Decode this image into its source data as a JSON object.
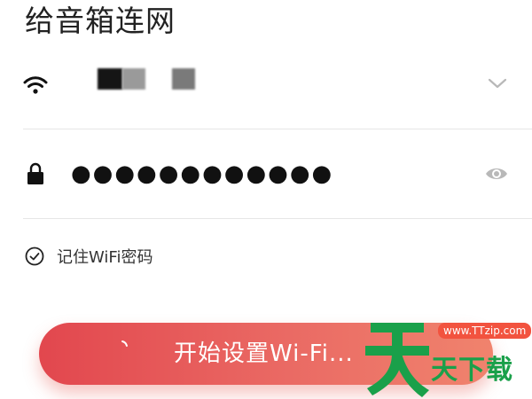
{
  "page": {
    "title": "给音箱连网"
  },
  "wifi": {
    "icon": "wifi-icon",
    "ssid": "",
    "ssid_obscured": true,
    "dropdown_icon": "chevron-down-icon"
  },
  "password": {
    "icon": "lock-icon",
    "value": "●●●●●●●●●●●●",
    "type": "password",
    "toggle_icon": "eye-icon"
  },
  "remember": {
    "icon": "check-circle-icon",
    "label": "记住WiFi密码",
    "checked": true
  },
  "start_button": {
    "label": "开始设置Wi-Fi...",
    "loading": true
  },
  "watermark": {
    "url": "www.TTzip.com",
    "text": "天下载",
    "mark_icon": "tian-character-logo"
  },
  "colors": {
    "button_gradient_start": "#e2474e",
    "button_gradient_end": "#f0836d",
    "divider": "#e6e6e6",
    "icon_gray": "#b8b8b8",
    "watermark_green": "#1aa04a",
    "watermark_red": "#f2533f"
  }
}
